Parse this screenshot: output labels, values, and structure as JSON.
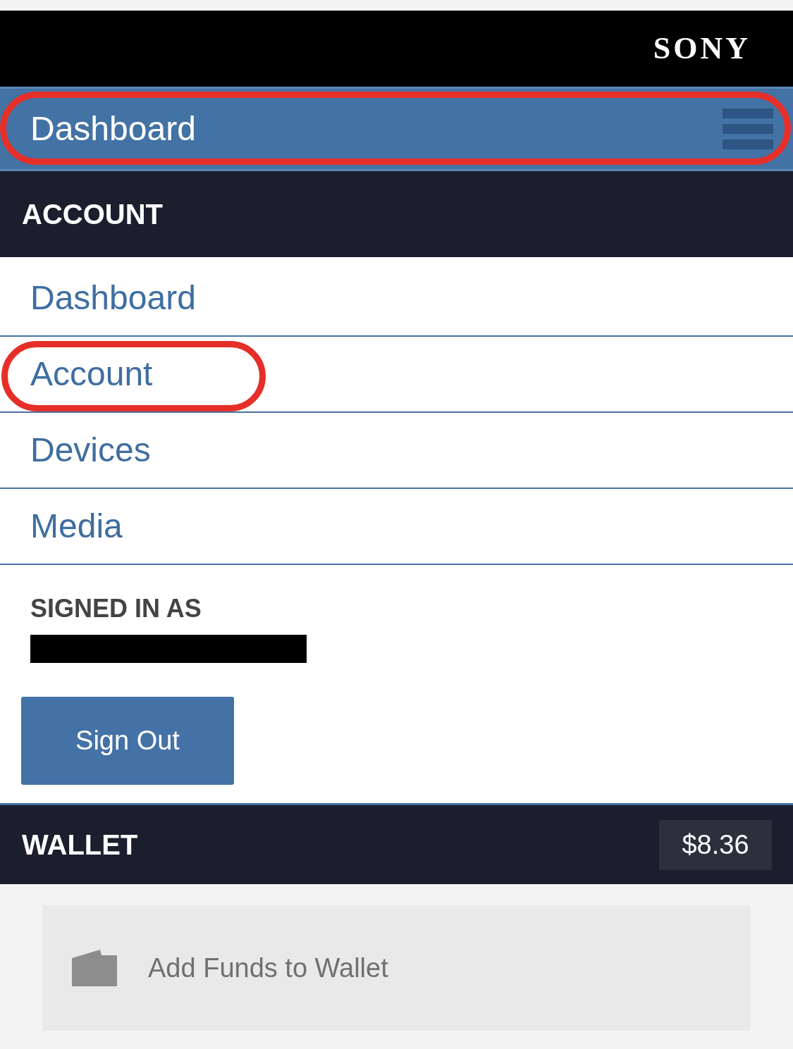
{
  "header": {
    "logo": "SONY"
  },
  "nav_bar": {
    "title": "Dashboard",
    "circled": true
  },
  "account_section": {
    "title": "ACCOUNT",
    "items": [
      {
        "label": "Dashboard",
        "circled": false
      },
      {
        "label": "Account",
        "circled": true
      },
      {
        "label": "Devices",
        "circled": false
      },
      {
        "label": "Media",
        "circled": false
      }
    ]
  },
  "signed_in": {
    "title": "SIGNED IN AS",
    "redacted": true,
    "button": "Sign Out"
  },
  "wallet": {
    "title": "WALLET",
    "balance": "$8.36",
    "action": "Add Funds to Wallet"
  }
}
